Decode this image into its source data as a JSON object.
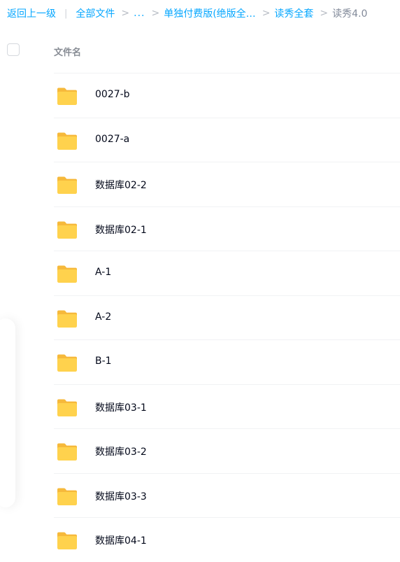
{
  "breadcrumb": {
    "back": "返回上一级",
    "divider": "|",
    "root": "全部文件",
    "ellipsis": "...",
    "folder_1": "单独付费版(绝版全…",
    "folder_2": "读秀全套",
    "current": "读秀4.0",
    "separator": ">"
  },
  "header": {
    "column_name": "文件名"
  },
  "files": [
    {
      "name": "0027-b",
      "icon": "folder-icon"
    },
    {
      "name": "0027-a",
      "icon": "folder-icon"
    },
    {
      "name": "数据库02-2",
      "icon": "folder-icon"
    },
    {
      "name": "数据库02-1",
      "icon": "folder-icon"
    },
    {
      "name": "A-1",
      "icon": "folder-icon"
    },
    {
      "name": "A-2",
      "icon": "folder-icon"
    },
    {
      "name": "B-1",
      "icon": "folder-icon"
    },
    {
      "name": "数据库03-1",
      "icon": "folder-icon"
    },
    {
      "name": "数据库03-2",
      "icon": "folder-icon"
    },
    {
      "name": "数据库03-3",
      "icon": "folder-icon"
    },
    {
      "name": "数据库04-1",
      "icon": "folder-icon"
    }
  ],
  "colors": {
    "link": "#06a7ff",
    "folder_back": "#f6b93b",
    "folder_front": "#ffd24d"
  }
}
